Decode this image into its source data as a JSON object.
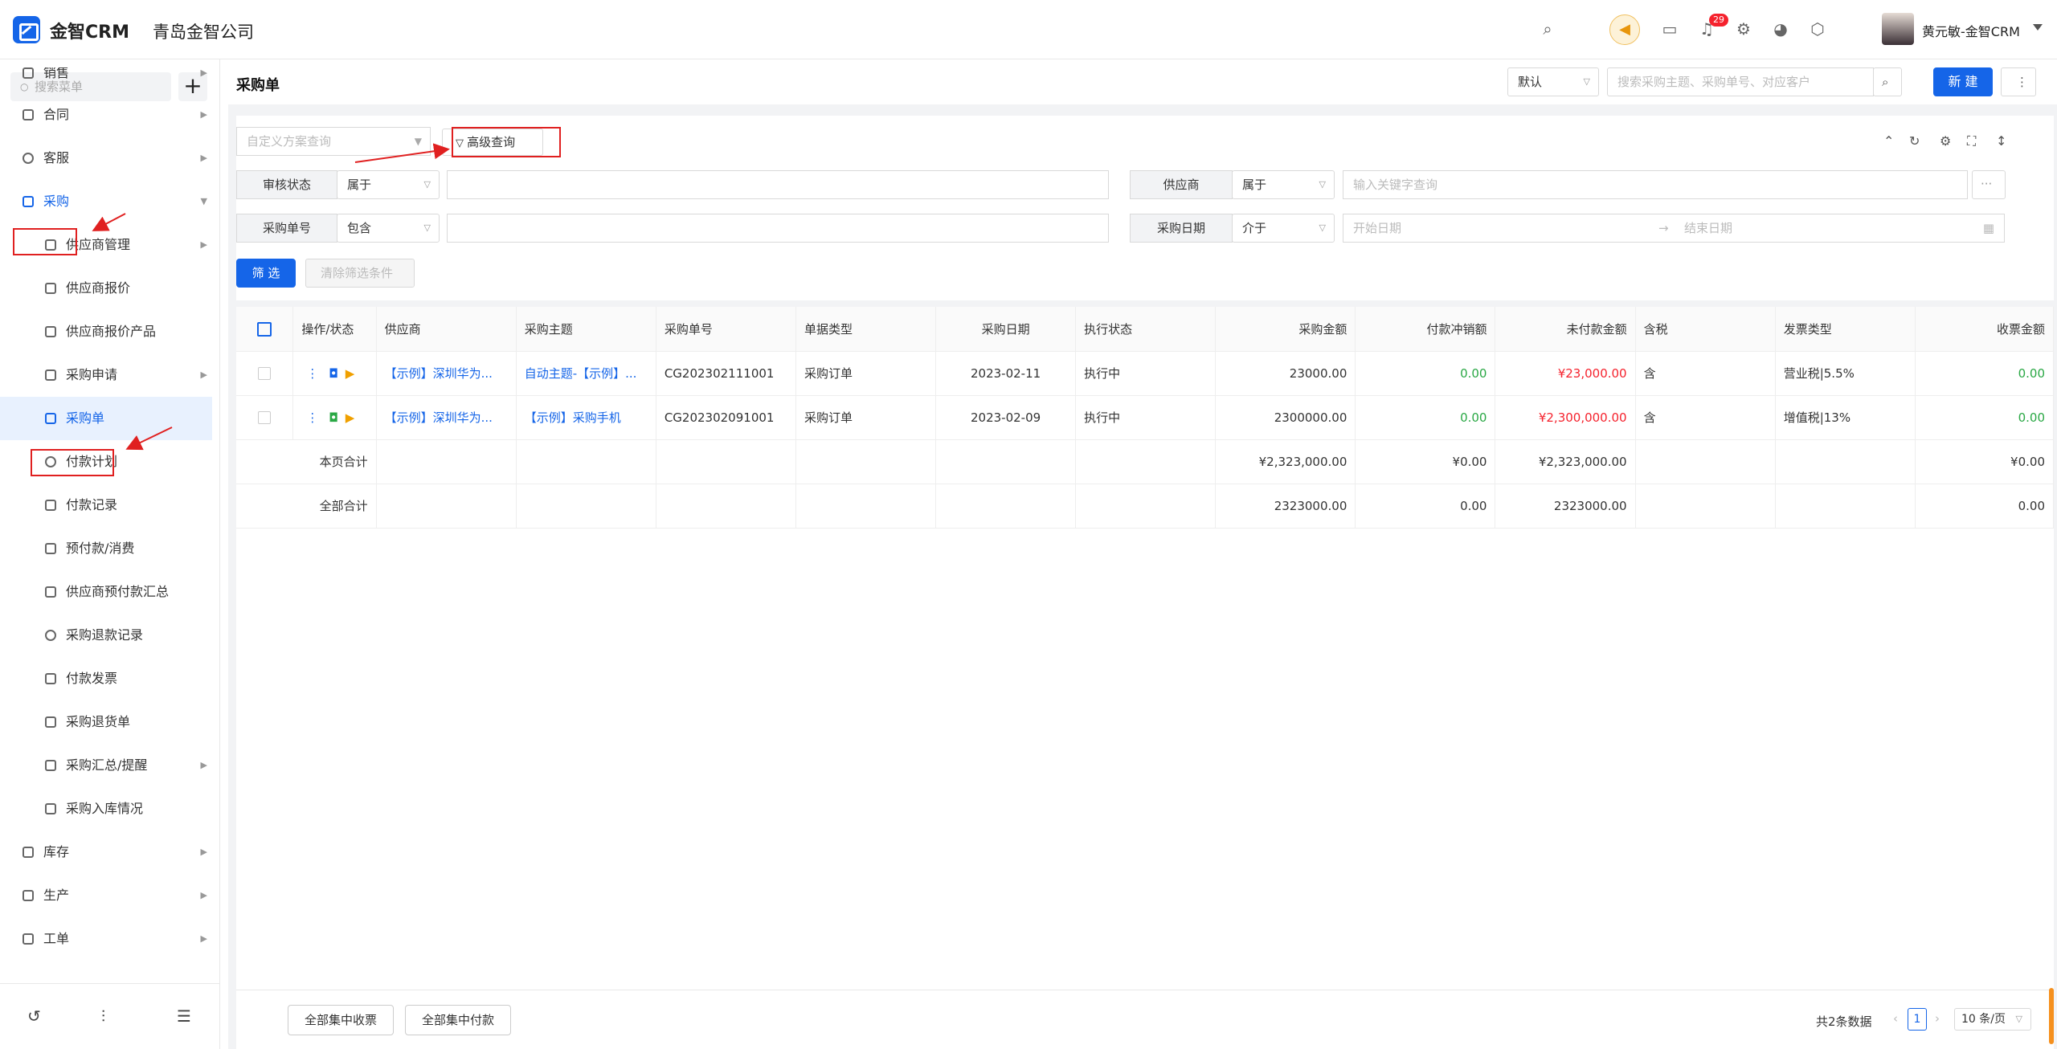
{
  "header": {
    "brand": "金智CRM",
    "company": "青岛金智公司",
    "notification_count": "29",
    "user_name": "黄元敏-金智CRM"
  },
  "sidebar": {
    "search_placeholder": "搜索菜单",
    "items": [
      {
        "label": "销售"
      },
      {
        "label": "合同"
      },
      {
        "label": "客服"
      },
      {
        "label": "采购"
      },
      {
        "label": "供应商管理"
      },
      {
        "label": "供应商报价"
      },
      {
        "label": "供应商报价产品"
      },
      {
        "label": "采购申请"
      },
      {
        "label": "采购单"
      },
      {
        "label": "付款计划"
      },
      {
        "label": "付款记录"
      },
      {
        "label": "预付款/消费"
      },
      {
        "label": "供应商预付款汇总"
      },
      {
        "label": "采购退款记录"
      },
      {
        "label": "付款发票"
      },
      {
        "label": "采购退货单"
      },
      {
        "label": "采购汇总/提醒"
      },
      {
        "label": "采购入库情况"
      },
      {
        "label": "库存"
      },
      {
        "label": "生产"
      },
      {
        "label": "工单"
      }
    ]
  },
  "page": {
    "title": "采购单",
    "view_select": "默认",
    "search_placeholder": "搜索采购主题、采购单号、对应客户",
    "new_button": "新 建",
    "more_button": "⋮"
  },
  "filters": {
    "scheme_placeholder": "自定义方案查询",
    "advanced_query": "高级查询",
    "audit_status_label": "审核状态",
    "audit_status_op": "属于",
    "supplier_label": "供应商",
    "supplier_op": "属于",
    "supplier_placeholder": "输入关键字查询",
    "order_no_label": "采购单号",
    "order_no_op": "包含",
    "date_label": "采购日期",
    "date_op": "介于",
    "start_date_placeholder": "开始日期",
    "end_date_placeholder": "结束日期",
    "filter_button": "筛 选",
    "clear_button": "清除筛选条件"
  },
  "table": {
    "headers": [
      "操作/状态",
      "供应商",
      "采购主题",
      "采购单号",
      "单据类型",
      "采购日期",
      "执行状态",
      "采购金额",
      "付款冲销额",
      "未付款金额",
      "含税",
      "发票类型",
      "收票金额"
    ],
    "rows": [
      {
        "supplier": "【示例】深圳华为...",
        "subject": "自动主题-【示例】...",
        "order_no": "CG202302111001",
        "doc_type": "采购订单",
        "date": "2023-02-11",
        "exec_status": "执行中",
        "amount": "23000.00",
        "writeoff": "0.00",
        "unpaid": "¥23,000.00",
        "tax": "含",
        "invoice_type": "营业税|5.5%",
        "received": "0.00"
      },
      {
        "supplier": "【示例】深圳华为...",
        "subject": "【示例】采购手机",
        "order_no": "CG202302091001",
        "doc_type": "采购订单",
        "date": "2023-02-09",
        "exec_status": "执行中",
        "amount": "2300000.00",
        "writeoff": "0.00",
        "unpaid": "¥2,300,000.00",
        "tax": "含",
        "invoice_type": "增值税|13%",
        "received": "0.00"
      }
    ],
    "page_total": {
      "label": "本页合计",
      "amount": "¥2,323,000.00",
      "writeoff": "¥0.00",
      "unpaid": "¥2,323,000.00",
      "received": "¥0.00"
    },
    "all_total": {
      "label": "全部合计",
      "amount": "2323000.00",
      "writeoff": "0.00",
      "unpaid": "2323000.00",
      "received": "0.00"
    }
  },
  "footer": {
    "collect_all": "全部集中收票",
    "pay_all": "全部集中付款",
    "total_text": "共2条数据",
    "current_page": "1",
    "page_size": "10 条/页"
  },
  "colors": {
    "primary": "#1565e8",
    "green": "#2aa845",
    "red": "#f5222d",
    "annotation": "#e02020"
  }
}
